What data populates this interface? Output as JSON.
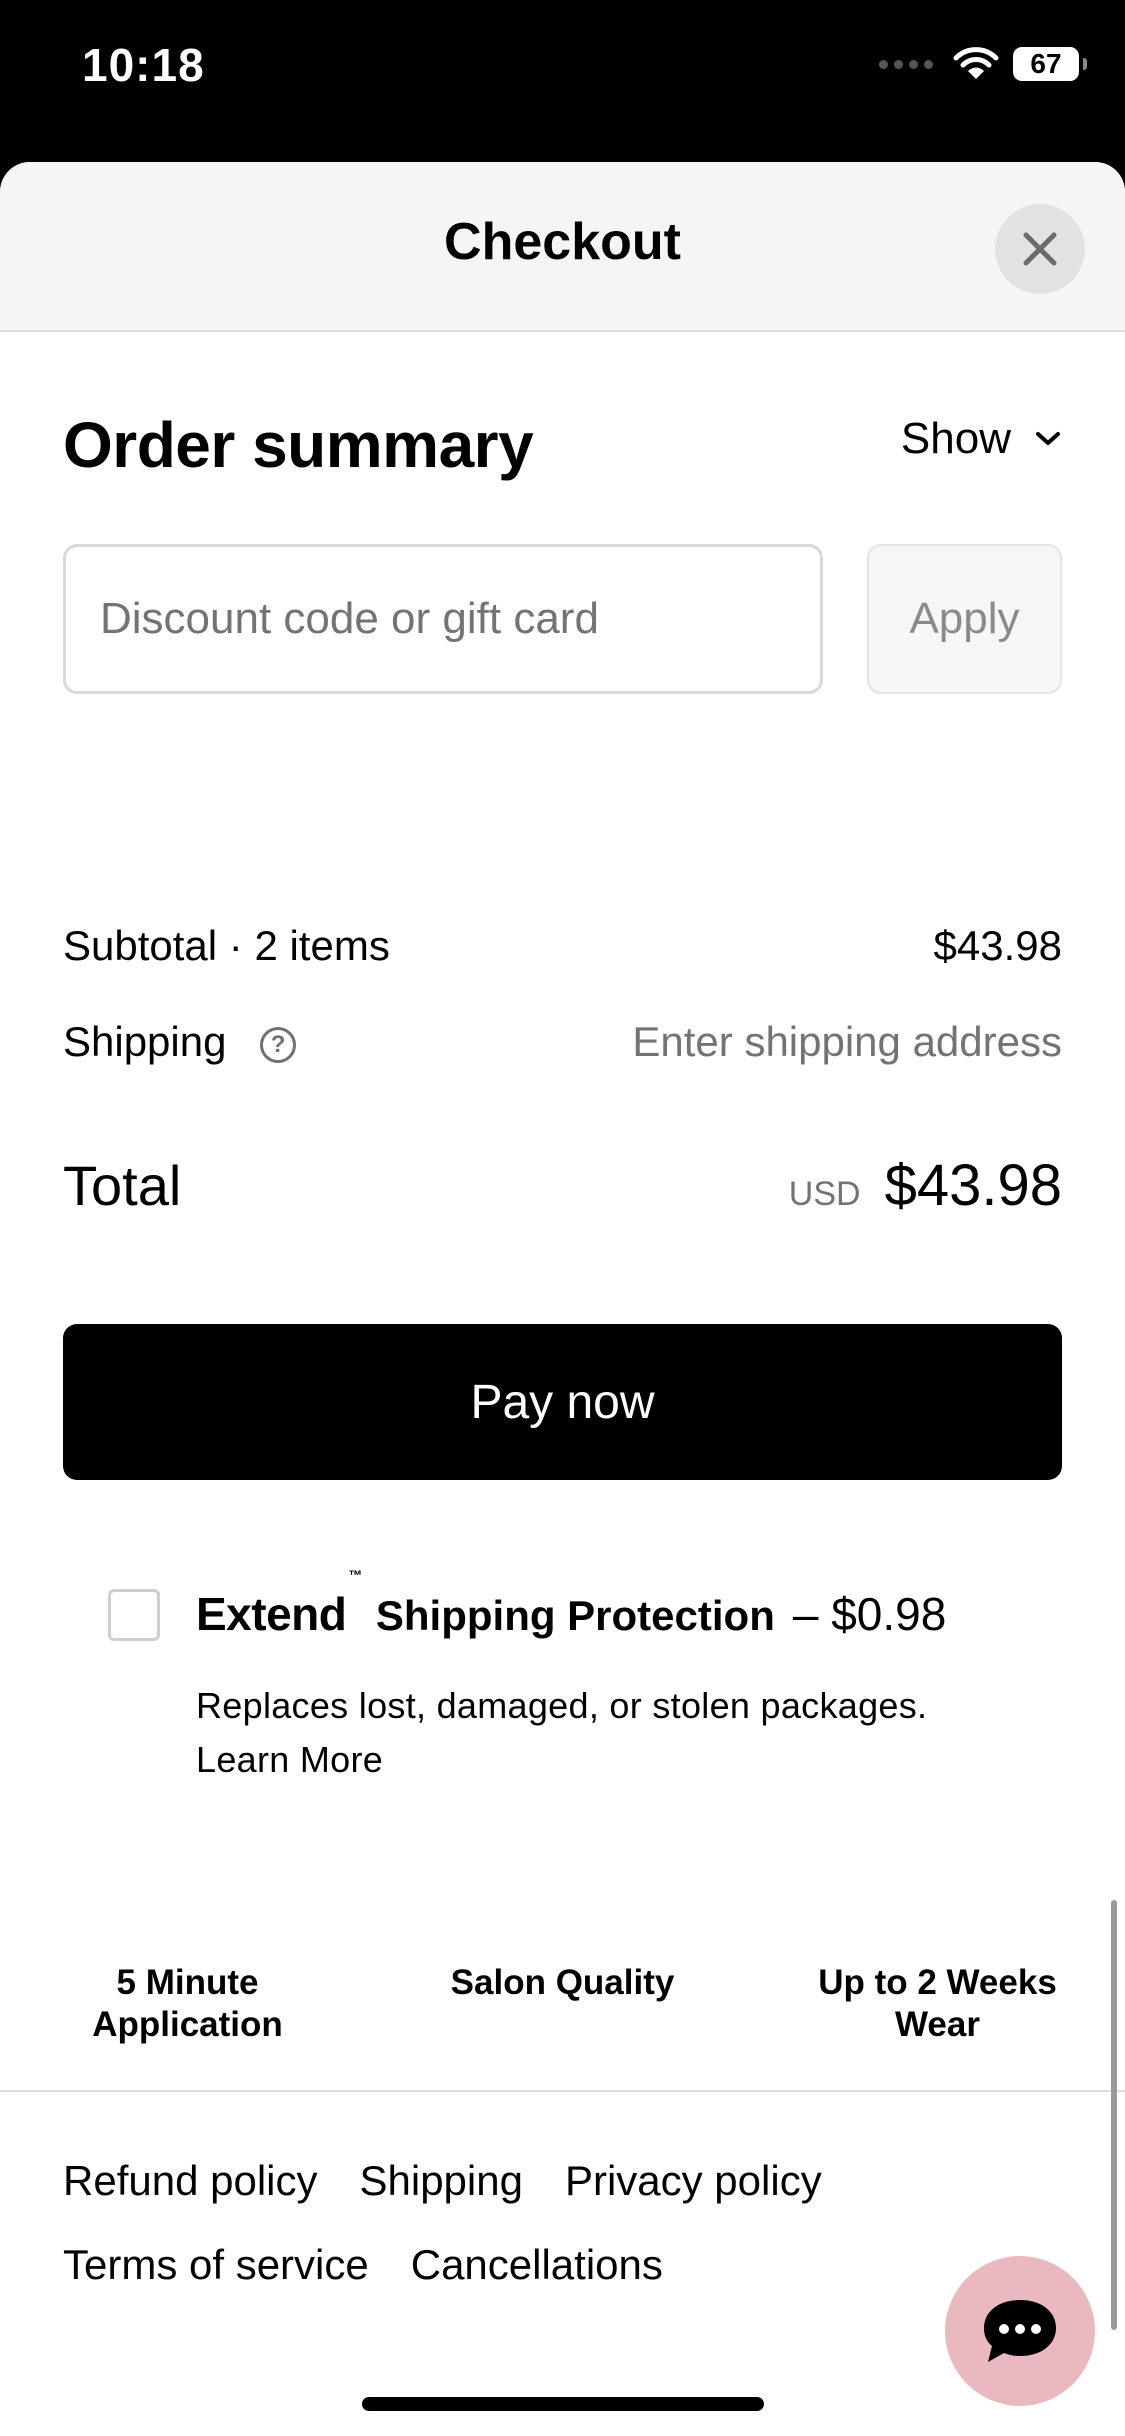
{
  "status_bar": {
    "time": "10:18",
    "battery": "67"
  },
  "header": {
    "title": "Checkout"
  },
  "order_summary": {
    "title": "Order summary",
    "toggle_label": "Show",
    "discount_placeholder": "Discount code or gift card",
    "apply_label": "Apply",
    "subtotal_label": "Subtotal · 2 items",
    "subtotal_value": "$43.98",
    "shipping_label": "Shipping",
    "shipping_value": "Enter shipping address",
    "total_label": "Total",
    "currency": "USD",
    "total_value": "$43.98"
  },
  "pay_button": {
    "label": "Pay now"
  },
  "extend": {
    "logo": "Extend",
    "tm": "™",
    "product": "Shipping Protection",
    "price": "– $0.98",
    "description": "Replaces lost, damaged, or stolen packages.",
    "learn_more": "Learn More",
    "checked": false
  },
  "features": [
    {
      "line1": "5 Minute",
      "line2": "Application"
    },
    {
      "line1": "Salon Quality",
      "line2": ""
    },
    {
      "line1": "Up to 2 Weeks",
      "line2": "Wear"
    }
  ],
  "footer_links": [
    "Refund policy",
    "Shipping",
    "Privacy policy",
    "Terms of service",
    "Cancellations"
  ],
  "icons": {
    "close": "close-icon",
    "chevron": "chevron-down-icon",
    "help": "help-icon",
    "chat": "chat-icon",
    "wifi": "wifi-icon",
    "battery": "battery-icon"
  },
  "colors": {
    "pay_button": "#000000",
    "chat_button": "#e9b9bf",
    "header_bg": "#f5f5f5",
    "muted_text": "#737373"
  }
}
